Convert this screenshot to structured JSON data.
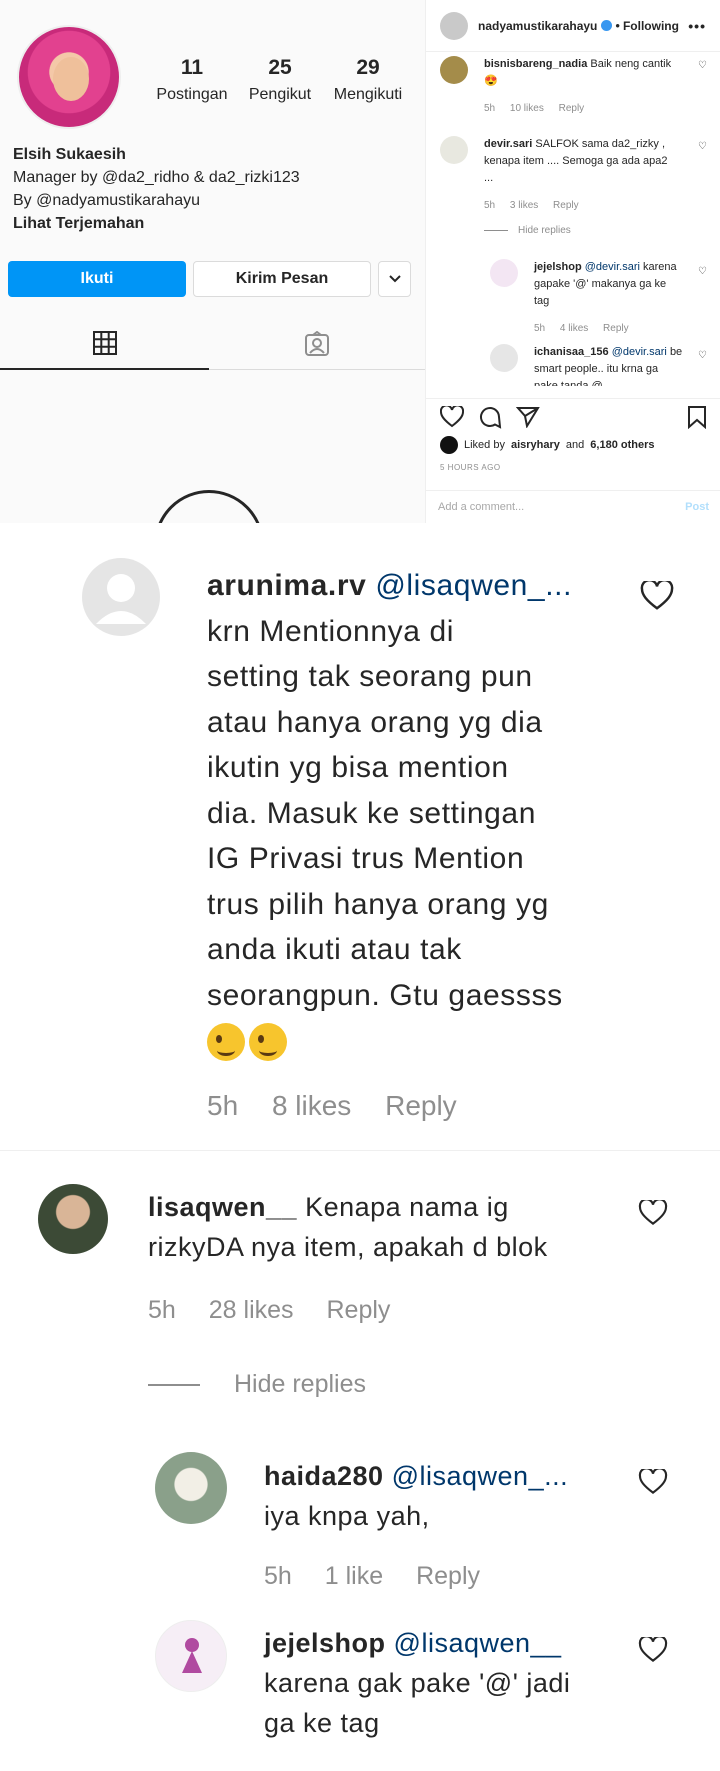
{
  "profile": {
    "stats": [
      {
        "num": "11",
        "label": "Postingan"
      },
      {
        "num": "25",
        "label": "Pengikut"
      },
      {
        "num": "29",
        "label": "Mengikuti"
      }
    ],
    "name": "Elsih Sukaesih",
    "bio_line1": "Manager by @da2_ridho & da2_rizki123",
    "bio_line2": "By @nadyamustikarahayu",
    "translate": "Lihat Terjemahan",
    "follow_label": "Ikuti",
    "message_label": "Kirim Pesan",
    "more_label": "⌄"
  },
  "post": {
    "username": "nadyamustikarahayu",
    "separator": "•",
    "following": "Following",
    "menu": "•••",
    "comments": [
      {
        "user": "bisnisbareng_nadia",
        "text": "Baik neng cantik 😍",
        "time": "5h",
        "likes": "10 likes",
        "reply": "Reply"
      },
      {
        "user": "devir.sari",
        "text": "SALFOK sama da2_rizky , kenapa item .... Semoga ga ada apa2 ...",
        "time": "5h",
        "likes": "3 likes",
        "reply": "Reply"
      }
    ],
    "hide_replies": "Hide replies",
    "replies": [
      {
        "user": "jejelshop",
        "mention": "@devir.sari",
        "text": "karena gapake '@' makanya ga ke tag",
        "time": "5h",
        "likes": "4 likes",
        "reply": "Reply"
      },
      {
        "user": "ichanisaa_156",
        "mention": "@devir.sari",
        "text": "be smart people.. itu krna ga pake tanda @"
      }
    ],
    "liked_by_prefix": "Liked by",
    "liked_by_user": "aisryhary",
    "liked_by_suffix": "and",
    "liked_by_count": "6,180 others",
    "time_ago": "5 HOURS AGO",
    "add_comment_placeholder": "Add a comment...",
    "post_label": "Post"
  },
  "zoom": {
    "arunima": {
      "user": "arunima.rv",
      "mention": "@lisaqwen_...",
      "lines": [
        "krn Mentionnya di",
        "setting tak seorang pun",
        "atau hanya orang yg dia",
        "ikutin yg bisa mention",
        "dia. Masuk ke settingan",
        "IG Privasi trus Mention",
        "trus pilih hanya orang yg",
        "anda ikuti atau tak",
        "seorangpun. Gtu gaessss"
      ],
      "time": "5h",
      "likes": "8 likes",
      "reply": "Reply"
    },
    "lisa": {
      "user": "lisaqwen__",
      "line1": "Kenapa nama ig",
      "line2": "rizkyDA nya item, apakah d blok",
      "time": "5h",
      "likes": "28 likes",
      "reply": "Reply"
    },
    "hide_replies": "Hide replies",
    "haida": {
      "user": "haida280",
      "mention": "@lisaqwen_...",
      "text": "iya knpa yah,",
      "time": "5h",
      "likes": "1 like",
      "reply": "Reply"
    },
    "jejel": {
      "user": "jejelshop",
      "mention": "@lisaqwen__",
      "line1": "karena gak pake '@' jadi",
      "line2": "ga ke tag"
    }
  },
  "colors": {
    "accent": "#0095f6",
    "mention": "#00376b",
    "muted": "#8e8e8e"
  }
}
